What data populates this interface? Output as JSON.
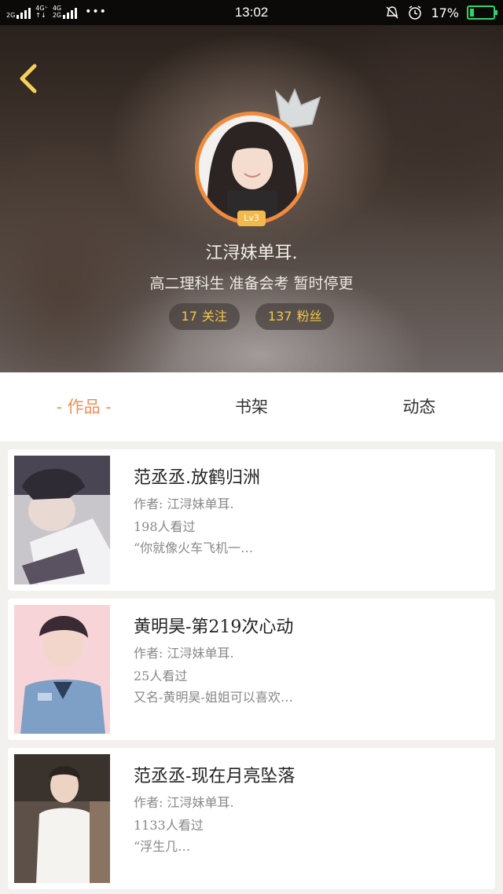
{
  "status_bar": {
    "sim1": "2G",
    "sim2_top": "4G⁺",
    "sim2_bottom": "↑↓",
    "sim3_top": "4G",
    "sim3_bottom": "2G",
    "dots": "•••",
    "time": "13:02",
    "battery_text": "17%",
    "battery_level": 0.17,
    "icons": [
      "bell-muted-icon",
      "alarm-icon",
      "battery-charging-icon"
    ]
  },
  "header": {
    "back_icon": "chevron-left-icon",
    "crown_icon": "crown-icon",
    "level": "Lv3",
    "username": "江浔妹单耳.",
    "bio": "高二理科生 准备会考 暂时停更",
    "following_count": "17",
    "following_label": "关注",
    "followers_count": "137",
    "followers_label": "粉丝",
    "accent": "#f08a3c",
    "stat_color": "#f2c64a"
  },
  "tabs": [
    {
      "label": "- 作品 -",
      "active": true
    },
    {
      "label": "书架",
      "active": false
    },
    {
      "label": "动态",
      "active": false
    }
  ],
  "works": [
    {
      "title": "范丞丞.放鹤归洲",
      "author": "作者: 江浔妹单耳.",
      "views": "198人看过",
      "excerpt": "“你就像火车飞机一…"
    },
    {
      "title": "黄明昊-第219次心动",
      "author": "作者: 江浔妹单耳.",
      "views": "25人看过",
      "excerpt": "又名-黄明昊-姐姐可以喜欢…"
    },
    {
      "title": "范丞丞-现在月亮坠落",
      "author": "作者: 江浔妹单耳.",
      "views": "1133人看过",
      "excerpt": "“浮生几…"
    }
  ]
}
